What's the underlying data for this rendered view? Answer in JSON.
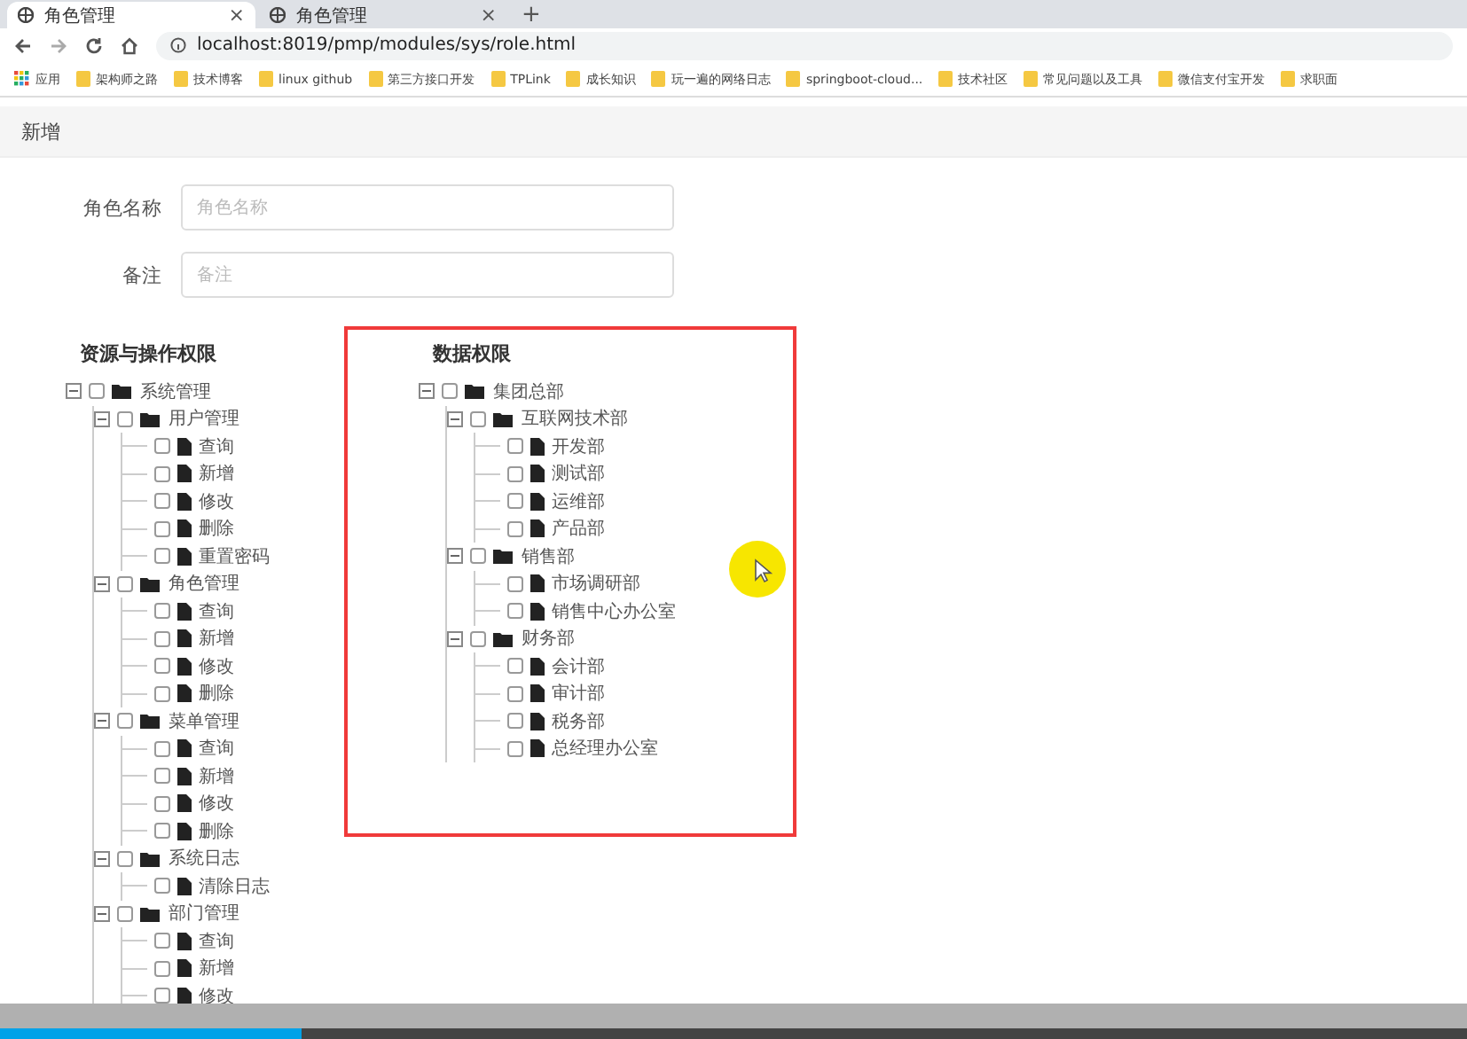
{
  "browser": {
    "tabs": [
      {
        "title": "角色管理",
        "close": "×",
        "selected": true
      },
      {
        "title": "角色管理",
        "close": "×",
        "selected": false
      }
    ],
    "new_tab": "+",
    "address": "localhost:8019/pmp/modules/sys/role.html",
    "bookmarks": [
      {
        "label": "应用",
        "kind": "apps"
      },
      {
        "label": "架构师之路",
        "kind": "folder"
      },
      {
        "label": "技术博客",
        "kind": "folder"
      },
      {
        "label": "linux github",
        "kind": "folder"
      },
      {
        "label": "第三方接口开发",
        "kind": "folder"
      },
      {
        "label": "TPLink",
        "kind": "folder"
      },
      {
        "label": "成长知识",
        "kind": "folder"
      },
      {
        "label": "玩一遍的网络日志",
        "kind": "folder"
      },
      {
        "label": "springboot-cloud...",
        "kind": "folder"
      },
      {
        "label": "技术社区",
        "kind": "folder"
      },
      {
        "label": "常见问题以及工具",
        "kind": "folder"
      },
      {
        "label": "微信支付宝开发",
        "kind": "folder"
      },
      {
        "label": "求职面",
        "kind": "folder"
      }
    ]
  },
  "page_title": "新增",
  "form": [
    {
      "label": "角色名称",
      "placeholder": "角色名称"
    },
    {
      "label": "备注",
      "placeholder": "备注"
    }
  ],
  "resource_tree": {
    "title": "资源与操作权限",
    "nodes": [
      {
        "label": "系统管理",
        "expanded": true,
        "checked": false,
        "children": [
          {
            "label": "用户管理",
            "expanded": true,
            "checked": false,
            "children": [
              {
                "label": "查询",
                "checked": false
              },
              {
                "label": "新增",
                "checked": false
              },
              {
                "label": "修改",
                "checked": false
              },
              {
                "label": "删除",
                "checked": false
              },
              {
                "label": "重置密码",
                "checked": false
              }
            ]
          },
          {
            "label": "角色管理",
            "expanded": true,
            "checked": false,
            "children": [
              {
                "label": "查询",
                "checked": false
              },
              {
                "label": "新增",
                "checked": false
              },
              {
                "label": "修改",
                "checked": false
              },
              {
                "label": "删除",
                "checked": false
              }
            ]
          },
          {
            "label": "菜单管理",
            "expanded": true,
            "checked": false,
            "children": [
              {
                "label": "查询",
                "checked": false
              },
              {
                "label": "新增",
                "checked": false
              },
              {
                "label": "修改",
                "checked": false
              },
              {
                "label": "删除",
                "checked": false
              }
            ]
          },
          {
            "label": "系统日志",
            "expanded": true,
            "checked": false,
            "children": [
              {
                "label": "清除日志",
                "checked": false
              }
            ]
          },
          {
            "label": "部门管理",
            "expanded": true,
            "checked": false,
            "children": [
              {
                "label": "查询",
                "checked": false
              },
              {
                "label": "新增",
                "checked": false
              },
              {
                "label": "修改",
                "checked": false
              }
            ]
          }
        ]
      }
    ]
  },
  "data_tree": {
    "title": "数据权限",
    "highlighted": true,
    "nodes": [
      {
        "label": "集团总部",
        "expanded": true,
        "checked": false,
        "children": [
          {
            "label": "互联网技术部",
            "expanded": true,
            "checked": false,
            "children": [
              {
                "label": "开发部",
                "checked": false
              },
              {
                "label": "测试部",
                "checked": false
              },
              {
                "label": "运维部",
                "checked": false
              },
              {
                "label": "产品部",
                "checked": false
              }
            ]
          },
          {
            "label": "销售部",
            "expanded": true,
            "checked": false,
            "children": [
              {
                "label": "市场调研部",
                "checked": false
              },
              {
                "label": "销售中心办公室",
                "checked": false
              }
            ]
          },
          {
            "label": "财务部",
            "expanded": true,
            "checked": false,
            "children": [
              {
                "label": "会计部",
                "checked": false
              },
              {
                "label": "审计部",
                "checked": false
              },
              {
                "label": "税务部",
                "checked": false
              },
              {
                "label": "总经理办公室",
                "checked": false
              }
            ]
          }
        ]
      }
    ]
  },
  "video_progress": {
    "level": 0.205
  }
}
